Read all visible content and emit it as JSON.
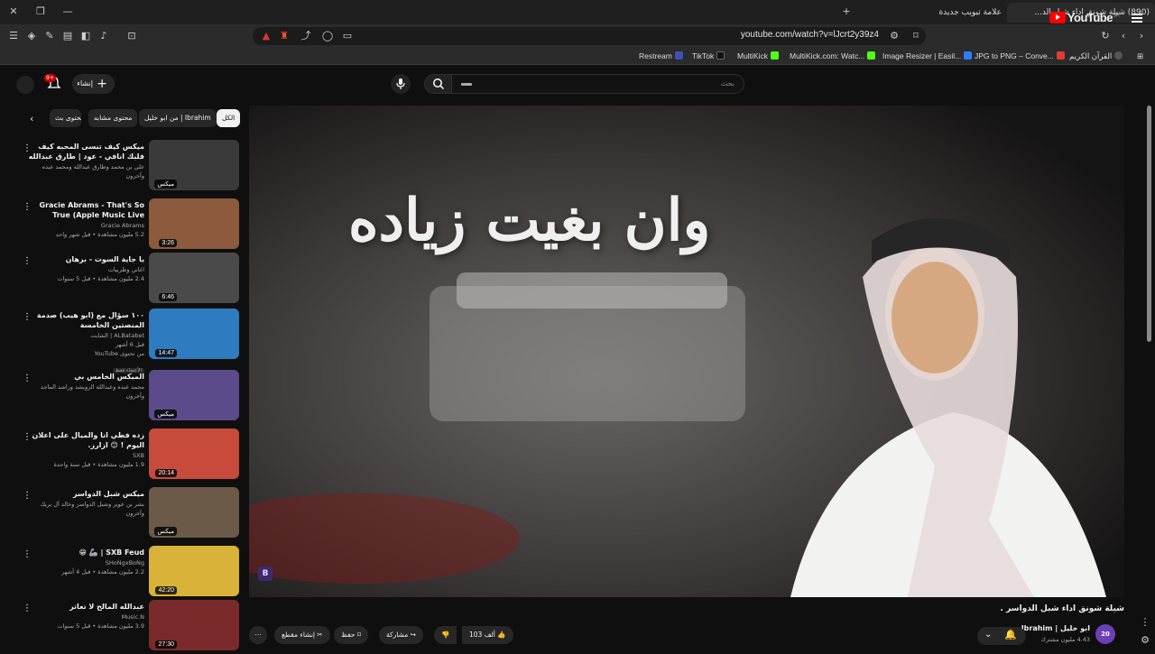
{
  "browser": {
    "active_tab": "(890) شيلة شونق اداء شبل الد...",
    "new_tab": "علامة تبويب جديدة",
    "url": "youtube.com/watch?v=lJcrt2y39z4",
    "bookmarks": [
      {
        "label": "Restream",
        "color": "#3f51b5"
      },
      {
        "label": "TikTok",
        "color": "#111111"
      },
      {
        "label": "MultiKick",
        "color": "#53fc18"
      },
      {
        "label": "MultiKick.com: Watc...",
        "color": "#53fc18"
      },
      {
        "label": "Image Resizer | Easil...",
        "color": "#2a7fff"
      },
      {
        "label": "JPG to PNG – Conve...",
        "color": "#e53935"
      },
      {
        "label": "القرآن الكريم",
        "color": "#555555"
      }
    ]
  },
  "header": {
    "logo_text": "YouTube",
    "logo_region": "SA",
    "search_placeholder": "بحث",
    "create_label": "إنشاء",
    "notif_count": "9+"
  },
  "chips": [
    "الكل",
    "من ابو خليل | Ibrahim",
    "محتوى مشابه",
    "محتوى بث"
  ],
  "recommendations": [
    {
      "title": "ميكس كيف تنسى المحبه كيف فلبك انافي - عود | طارق عبدالله",
      "channel": "علي بن محمد وطارق عبدالله ومحمد عبده وآخرون",
      "meta": "",
      "duration": "ميكس",
      "thumb": "#3a3a3a"
    },
    {
      "title": "Gracie Abrams - That's So True (Apple Music Live 2025)",
      "channel": "Gracie Abrams",
      "meta": "5.2 مليون مشاهدة • قبل شهر واحد",
      "duration": "3:26",
      "thumb": "#8c5a3c"
    },
    {
      "title": "يا جاية السوت - برهان",
      "channel": "اغاني وطربيات",
      "meta": "2.4 مليون مشاهدة • قبل 5 سنوات",
      "duration": "6:46",
      "thumb": "#4a4a4a"
    },
    {
      "title": "١٠٠ سؤال مع (ابو هيب) صدمة المنصتين الخامسة",
      "channel": "ALBatabet | الشابت",
      "meta": "قبل 6 أشهر",
      "duration": "14:47",
      "thumb": "#2e7bbf",
      "extra": "من تحتوى YouTube",
      "badge": "الأعضاء فقط"
    },
    {
      "title": "الميكس الخامس بي",
      "channel": "محمد عبده وعبدالله الرويشد وراشد الماجد وآخرون",
      "meta": "",
      "duration": "ميكس",
      "thumb": "#5b4b8a"
    },
    {
      "title": "زده فطي انا والميال على اعلان اليوم ! 😊 ازارز.",
      "channel": "SXB",
      "meta": "1.9 مليون مشاهدة • قبل سنة واحدة",
      "duration": "20:14",
      "thumb": "#c74a3a"
    },
    {
      "title": "ميكس شبل الدواسر",
      "channel": "بشر بن عوير وشبل الدواسر وخالد آل بريك وآخرون",
      "meta": "",
      "duration": "ميكس",
      "thumb": "#6b5a48"
    },
    {
      "title": "SXB Feud | 🦾 😁",
      "channel": "SHoNgxBoNg",
      "meta": "2.2 مليون مشاهدة • قبل 4 أشهر",
      "duration": "42:20",
      "thumb": "#d9b23a"
    },
    {
      "title": "عبدالله المالح لا تعاتر",
      "channel": "Music.N",
      "meta": "3.9 مليون مشاهدة • قبل 5 سنوات",
      "duration": "27:30",
      "thumb": "#7a2a2a"
    }
  ],
  "player": {
    "overlay_text": "وان بغيت زياده",
    "watermark": "B"
  },
  "video": {
    "title": "شيلة شونق اداء شبل الدواسر .",
    "channel_name": "ابو خليل | Ibrahim",
    "subscribers": "4.43 مليون مشترك",
    "avatar_text": "20",
    "likes": "103 ألف",
    "share_label": "مشاركة",
    "save_label": "حفظ",
    "clip_label": "إنشاء مقطع"
  }
}
